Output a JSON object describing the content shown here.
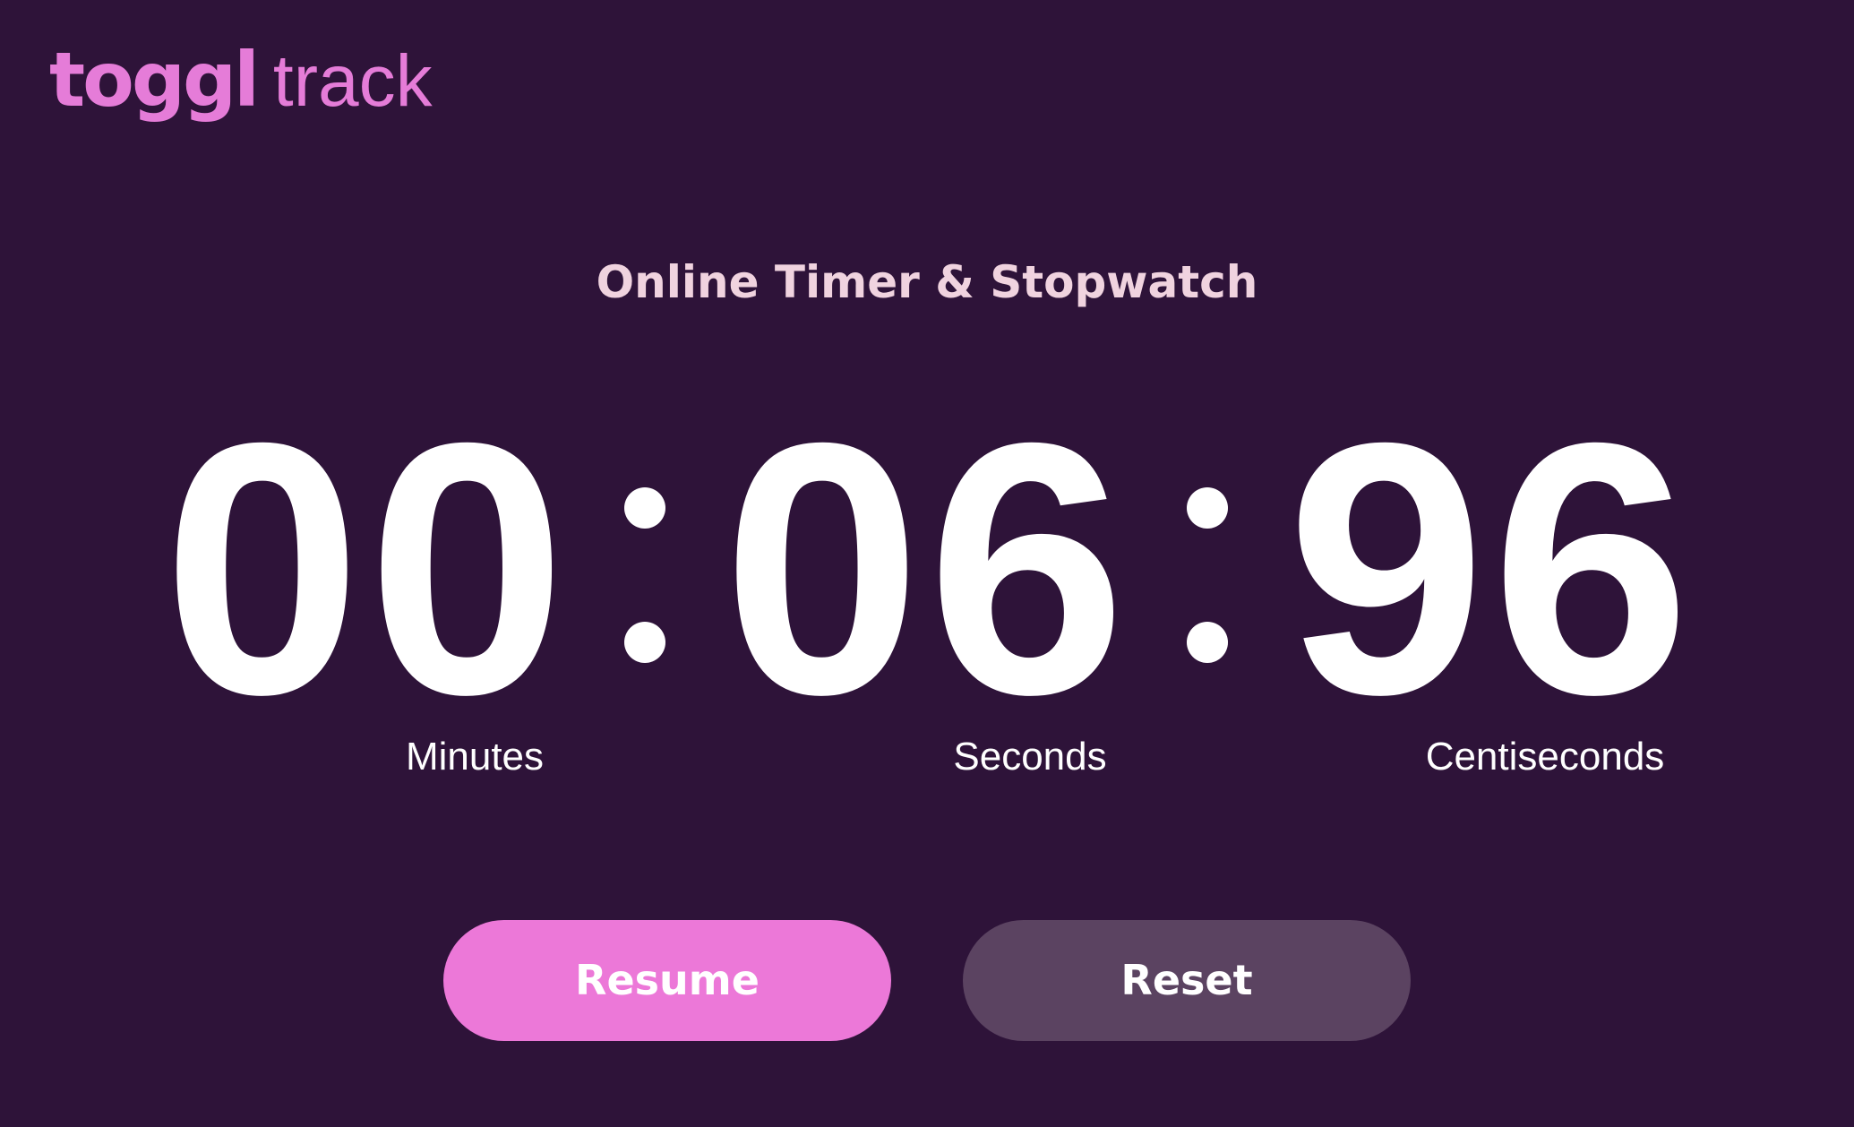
{
  "logo": {
    "primary": "toggl",
    "secondary": "track"
  },
  "page": {
    "title": "Online Timer & Stopwatch"
  },
  "timer": {
    "minutes": "00",
    "seconds": "06",
    "centiseconds": "96",
    "separator": ":",
    "labels": {
      "minutes": "Minutes",
      "seconds": "Seconds",
      "centiseconds": "Centiseconds"
    }
  },
  "controls": {
    "resume_label": "Resume",
    "reset_label": "Reset"
  },
  "colors": {
    "background": "#2e1339",
    "brand_pink": "#e57cd8",
    "title": "#f0d3df",
    "resume_button": "#ec78d8",
    "reset_button": "#5b4361"
  }
}
